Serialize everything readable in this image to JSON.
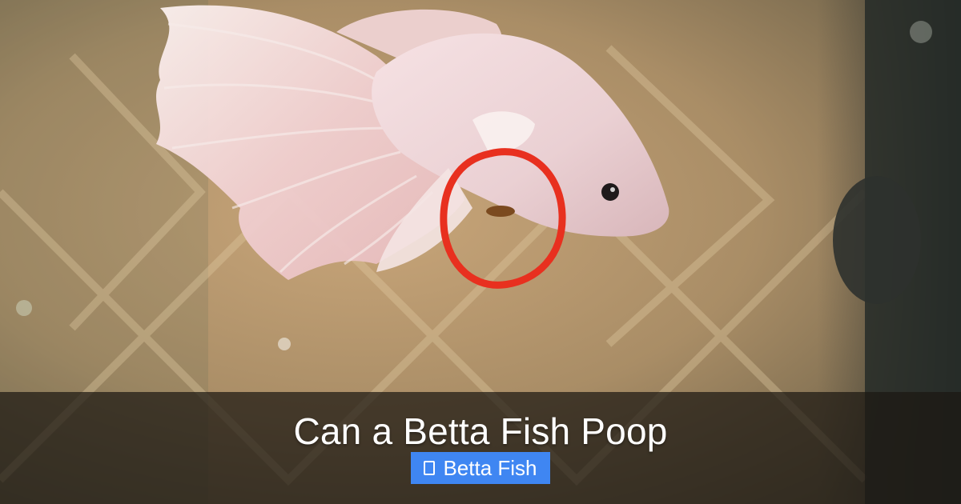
{
  "post": {
    "title": "Can a Betta Fish Poop",
    "category": "Betta Fish",
    "category_icon": "folder-icon"
  },
  "colors": {
    "category_badge": "#3f86f2",
    "annotation_circle": "#e8301f",
    "caption_overlay": "#1c1812"
  }
}
